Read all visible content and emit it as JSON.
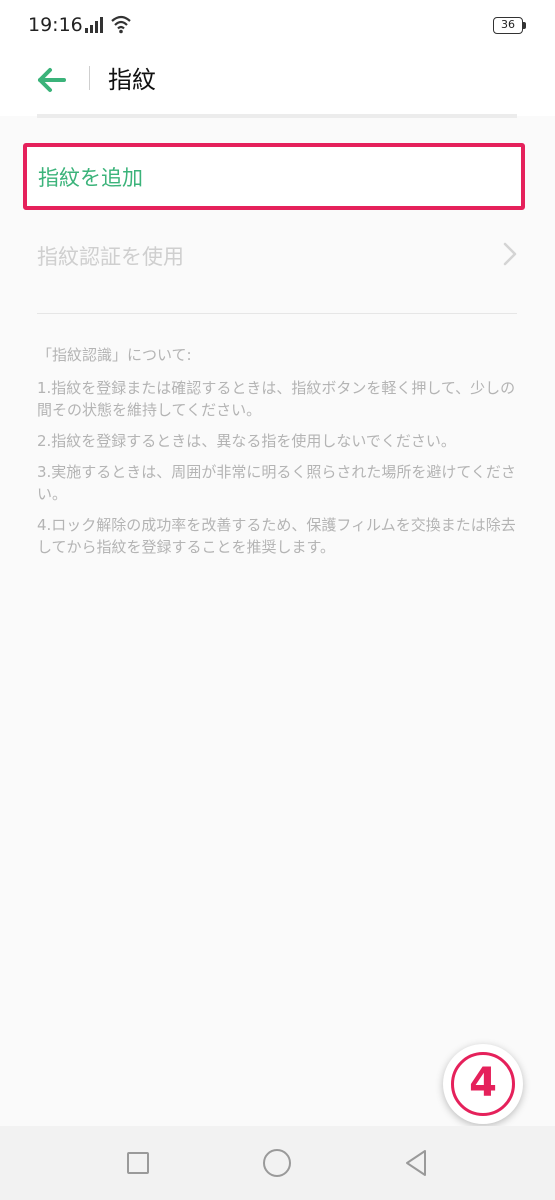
{
  "status_bar": {
    "time": "19:16",
    "battery": "36",
    "icons": [
      "signal-icon",
      "wifi-icon",
      "battery-icon"
    ]
  },
  "header": {
    "back_icon": "arrow-left-icon",
    "title": "指紋"
  },
  "rows": {
    "add_fingerprint": "指紋を追加",
    "use_fingerprint": "指紋認証を使用",
    "use_chevron_icon": "chevron-right-icon"
  },
  "info": {
    "title": "「指紋認識」について:",
    "items": [
      "1.指紋を登録または確認するときは、指紋ボタンを軽く押して、少しの間その状態を維持してください。",
      "2.指紋を登録するときは、異なる指を使用しないでください。",
      "3.実施するときは、周囲が非常に明るく照らされた場所を避けてください。",
      "4.ロック解除の成功率を改善するため、保護フィルムを交換または除去してから指紋を登録することを推奨します。"
    ]
  },
  "badge": {
    "label": "4"
  },
  "nav_bar": {
    "icons": [
      "recent-apps-icon",
      "home-icon",
      "back-triangle-icon"
    ]
  },
  "colors": {
    "accent_green": "#3bb37a",
    "highlight_red": "#e5215b",
    "disabled_text": "#cfcfcf",
    "info_text": "#b4b4b4"
  }
}
